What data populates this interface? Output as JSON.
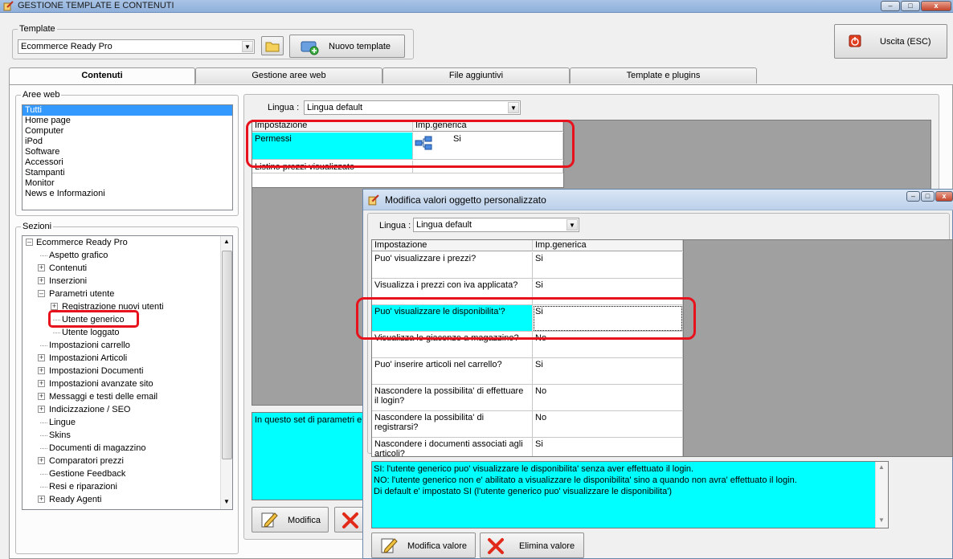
{
  "window": {
    "title": "GESTIONE TEMPLATE E CONTENUTI"
  },
  "template": {
    "legend": "Template",
    "selected": "Ecommerce Ready Pro",
    "new_button": "Nuovo template"
  },
  "exit_button": "Uscita (ESC)",
  "tabs": [
    "Contenuti",
    "Gestione aree web",
    "File aggiuntivi",
    "Template e plugins"
  ],
  "aree_web": {
    "legend": "Aree web",
    "items": [
      "Tutti",
      "Home page",
      "Computer",
      "iPod",
      "Software",
      "Accessori",
      "Stampanti",
      "Monitor",
      "News e Informazioni"
    ]
  },
  "sezioni": {
    "legend": "Sezioni",
    "root": "Ecommerce Ready Pro",
    "items": [
      {
        "label": "Aspetto grafico",
        "expander": false
      },
      {
        "label": "Contenuti",
        "expander": true
      },
      {
        "label": "Inserzioni",
        "expander": true
      },
      {
        "label": "Parametri utente",
        "expander": "open"
      },
      {
        "label": "Registrazione nuovi utenti",
        "expander": true
      },
      {
        "label": "Utente generico",
        "expander": false
      },
      {
        "label": "Utente loggato",
        "expander": false
      },
      {
        "label": "Impostazioni carrello",
        "expander": false
      },
      {
        "label": "Impostazioni Articoli",
        "expander": true
      },
      {
        "label": "Impostazioni Documenti",
        "expander": true
      },
      {
        "label": "Impostazioni avanzate sito",
        "expander": true
      },
      {
        "label": "Messaggi e testi delle email",
        "expander": true
      },
      {
        "label": "Indicizzazione / SEO",
        "expander": true
      },
      {
        "label": "Lingue",
        "expander": false
      },
      {
        "label": "Skins",
        "expander": false
      },
      {
        "label": "Documenti di magazzino",
        "expander": false
      },
      {
        "label": "Comparatori prezzi",
        "expander": true
      },
      {
        "label": "Gestione Feedback",
        "expander": false
      },
      {
        "label": "Resi e riparazioni",
        "expander": false
      },
      {
        "label": "Ready Agenti",
        "expander": true
      }
    ]
  },
  "main": {
    "lingua_label": "Lingua :",
    "lingua_value": "Lingua default",
    "columns": [
      "Impostazione",
      "Imp.generica"
    ],
    "rows": [
      {
        "name": "Permessi",
        "value": "Si"
      },
      {
        "name": "Listino prezzi visualizzato",
        "value": ""
      }
    ],
    "description": "In questo set di parametri e'",
    "modify_button": "Modifica"
  },
  "dialog": {
    "title": "Modifica valori oggetto personalizzato",
    "lingua_label": "Lingua :",
    "lingua_value": "Lingua default",
    "columns": [
      "Impostazione",
      "Imp.generica"
    ],
    "rows": [
      {
        "name": "Puo' visualizzare i prezzi?",
        "value": "Si"
      },
      {
        "name": "Visualizza i prezzi con iva applicata?",
        "value": "Si"
      },
      {
        "name": "Puo' visualizzare le disponibilita'?",
        "value": "Si"
      },
      {
        "name": "Visualizza le giacenze a magazzino?",
        "value": "No"
      },
      {
        "name": "Puo' inserire articoli nel carrello?",
        "value": "Si"
      },
      {
        "name": "Nascondere la possibilita' di effettuare il login?",
        "value": "No"
      },
      {
        "name": "Nascondere la possibilita' di registrarsi?",
        "value": "No"
      },
      {
        "name": "Nascondere i documenti associati agli articoli?",
        "value": "Si"
      }
    ],
    "help_lines": [
      "SI: l'utente generico puo' visualizzare le disponibilita' senza aver effettuato il login.",
      "NO: l'utente generico non e' abilitato a visualizzare le disponibilita' sino a quando non avra' effettuato il login.",
      "Di default e' impostato SI (l'utente generico puo' visualizzare le disponibilita')"
    ],
    "modify_value_button": "Modifica valore",
    "delete_value_button": "Elimina valore"
  },
  "colors": {
    "highlight": "#00ffff",
    "annotation": "#e8121c",
    "selection": "#3399ff"
  }
}
